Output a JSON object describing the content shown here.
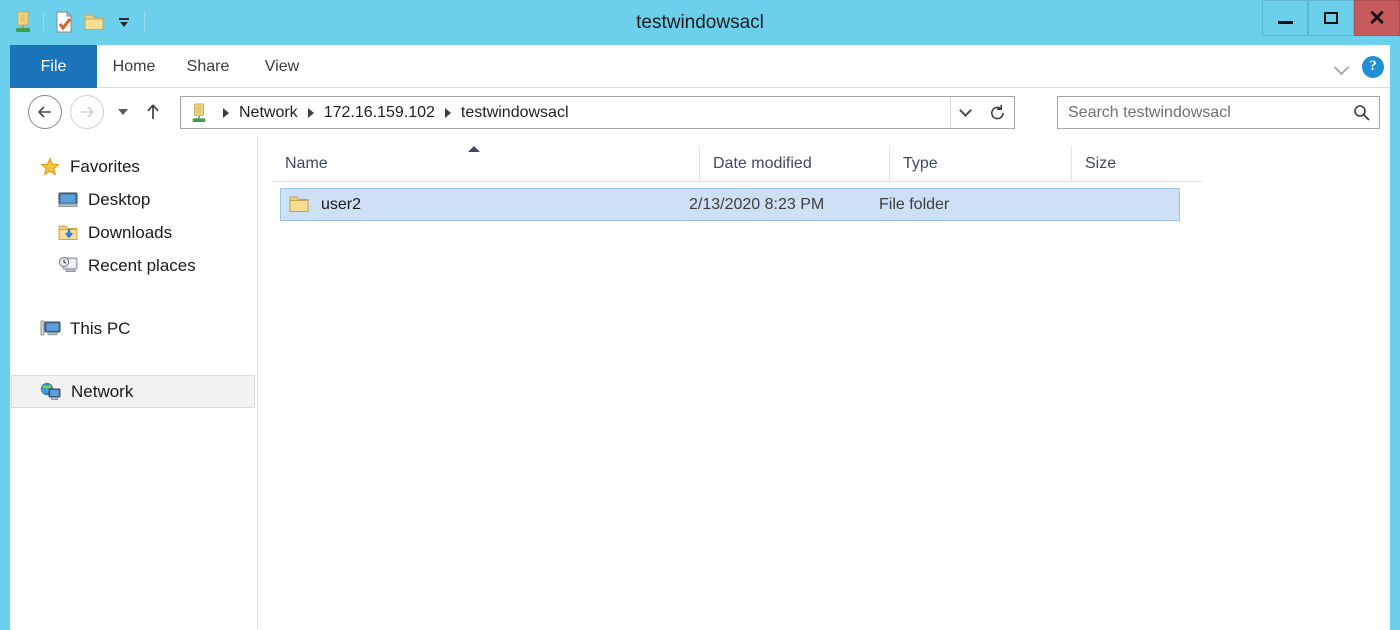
{
  "window": {
    "title": "testwindowsacl",
    "frame_color": "#6ccfec",
    "controls": {
      "minimize_label": "–",
      "maximize_label": "❑",
      "close_label": "×",
      "close_color": "#c75a5a"
    }
  },
  "quick_access": {
    "items": [
      {
        "name": "network-share-icon",
        "tooltip": "Network"
      },
      {
        "name": "properties-icon",
        "tooltip": "Properties"
      },
      {
        "name": "new-folder-icon",
        "tooltip": "New folder"
      },
      {
        "name": "customize-dropdown-icon",
        "tooltip": "Customize Quick Access Toolbar"
      }
    ]
  },
  "ribbon": {
    "tabs": [
      {
        "label": "File",
        "selected": true
      },
      {
        "label": "Home",
        "selected": false
      },
      {
        "label": "Share",
        "selected": false
      },
      {
        "label": "View",
        "selected": false
      }
    ],
    "file_tab_color": "#1b75bb",
    "expand_label": "⌄",
    "help_label": "?"
  },
  "navigation": {
    "back_label": "←",
    "forward_label": "→",
    "recent_dropdown_label": "▾",
    "up_label": "↑",
    "address": {
      "icon": "network-share-icon",
      "crumbs": [
        "Network",
        "172.16.159.102",
        "testwindowsacl"
      ],
      "history_chevron": "⌄",
      "refresh_label": "↻"
    },
    "search": {
      "placeholder": "Search testwindowsacl",
      "value": "",
      "icon": "search-icon"
    }
  },
  "sidebar": {
    "groups": [
      {
        "label": "Favorites",
        "icon": "star-icon",
        "selected": false,
        "children": [
          {
            "label": "Desktop",
            "icon": "desktop-icon",
            "selected": false
          },
          {
            "label": "Downloads",
            "icon": "downloads-icon",
            "selected": false
          },
          {
            "label": "Recent places",
            "icon": "recent-places-icon",
            "selected": false
          }
        ]
      },
      {
        "label": "This PC",
        "icon": "this-pc-icon",
        "selected": false,
        "children": []
      },
      {
        "label": "Network",
        "icon": "network-icon",
        "selected": true,
        "children": []
      }
    ]
  },
  "file_list": {
    "columns": [
      {
        "label": "Name",
        "sorted": true,
        "sort_direction": "asc"
      },
      {
        "label": "Date modified",
        "sorted": false
      },
      {
        "label": "Type",
        "sorted": false
      },
      {
        "label": "Size",
        "sorted": false
      }
    ],
    "rows": [
      {
        "name": "user2",
        "date_modified": "2/13/2020 8:23 PM",
        "type": "File folder",
        "size": "",
        "icon": "folder-icon",
        "selected": true
      }
    ],
    "selection_color": "#cde0f5"
  }
}
